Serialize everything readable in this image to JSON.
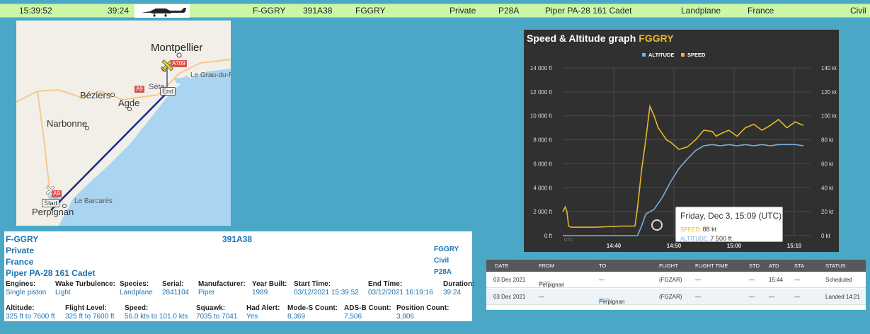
{
  "top_bar": {
    "time": "15:39:52",
    "duration": "39:24",
    "registration": "F-GGRY",
    "mode_s": "391A38",
    "callsign": "FGGRY",
    "owner": "Private",
    "type_code": "P28A",
    "model": "Piper PA-28 161 Cadet",
    "aircraft_class": "Landplane",
    "country": "France",
    "category": "Civil"
  },
  "map": {
    "cities": [
      "Montpellier",
      "Béziers",
      "Agde",
      "Narbonne",
      "Perpignan",
      "Sète"
    ],
    "towns": [
      "Le Grau-du-Roi",
      "Le Barcarès"
    ],
    "roads": [
      "A709",
      "A9",
      "A9"
    ],
    "markers": {
      "start": "Start",
      "end": "End"
    },
    "colors": {
      "sea": "#a9d4f2",
      "land": "#f2efe9",
      "track": "#1a2a8a"
    }
  },
  "info": {
    "registration": "F-GGRY",
    "mode_s": "391A38",
    "owner": "Private",
    "country": "France",
    "model": "Piper PA-28 161 Cadet",
    "callsign": "FGGRY",
    "category": "Civil",
    "type_code": "P28A",
    "row1": [
      {
        "label": "Engines:",
        "value": "Single piston"
      },
      {
        "label": "Wake Turbulence:",
        "value": "Light"
      },
      {
        "label": "Species:",
        "value": "Landplane"
      },
      {
        "label": "Serial:",
        "value": "2841104"
      },
      {
        "label": "Manufacturer:",
        "value": "Piper"
      },
      {
        "label": "Year Built:",
        "value": "1989"
      },
      {
        "label": "Start Time:",
        "value": "03/12/2021 15:39:52"
      },
      {
        "label": "End Time:",
        "value": "03/12/2021 16:19:16"
      },
      {
        "label": "Duration:",
        "value": "39:24"
      }
    ],
    "row2": [
      {
        "label": "Altitude:",
        "value": "325 ft to 7600 ft"
      },
      {
        "label": "Flight Level:",
        "value": "325 ft to 7600 ft"
      },
      {
        "label": "Speed:",
        "value": "56.0 kts to 101.0 kts"
      },
      {
        "label": "Squawk:",
        "value": "7035 to 7041"
      },
      {
        "label": "Had Alert:",
        "value": "Yes"
      },
      {
        "label": "Mode-S Count:",
        "value": "8,369"
      },
      {
        "label": "ADS-B Count:",
        "value": "7,506"
      },
      {
        "label": "Position Count:",
        "value": "3,806"
      }
    ]
  },
  "chart_data": {
    "type": "line",
    "title": "Speed & Altitude graph",
    "title_highlight": "FGGRY",
    "legend": [
      "ALTITUDE",
      "SPEED"
    ],
    "legend_position": "top-center",
    "grid": true,
    "x_tick_labels": [
      "UTC",
      "14:40",
      "14:50",
      "15:00",
      "15:10"
    ],
    "y_left_ticks": [
      "0 ft",
      "2 000 ft",
      "4 000 ft",
      "6 000 ft",
      "8 000 ft",
      "10 000 ft",
      "12 000 ft",
      "14 000 ft"
    ],
    "y_right_ticks": [
      "0 kt",
      "20 kt",
      "40 kt",
      "60 kt",
      "80 kt",
      "100 kt",
      "120 kt",
      "140 kt"
    ],
    "y_left_range": [
      0,
      14000
    ],
    "y_right_range": [
      0,
      140
    ],
    "x_range_minutes": [
      -9,
      20
    ],
    "series": [
      {
        "name": "ALTITUDE",
        "color": "#7aaede",
        "axis": "left",
        "x": [
          -9,
          0,
          0.5,
          1,
          2,
          3,
          4,
          5,
          6,
          7,
          8,
          9,
          10,
          11,
          12,
          13,
          14,
          15,
          16,
          17,
          18,
          19,
          20
        ],
        "y": [
          0,
          0,
          800,
          1800,
          2200,
          3200,
          4500,
          5600,
          6400,
          7100,
          7500,
          7600,
          7500,
          7600,
          7500,
          7600,
          7500,
          7600,
          7500,
          7600,
          7600,
          7600,
          7500
        ]
      },
      {
        "name": "SPEED",
        "color": "#e8b829",
        "axis": "right",
        "x": [
          -9,
          -8.7,
          -8.5,
          -8.3,
          -8,
          -5,
          -2,
          -0.3,
          0,
          0.5,
          1,
          1.5,
          2,
          2.5,
          3,
          3.5,
          4,
          5,
          6,
          7,
          8,
          9,
          9.5,
          10,
          11,
          12,
          13,
          14,
          15,
          16,
          17,
          18,
          19,
          20
        ],
        "y": [
          20,
          24,
          20,
          8,
          7,
          7,
          8,
          8,
          23,
          55,
          80,
          108,
          100,
          90,
          85,
          80,
          78,
          72,
          74,
          80,
          88,
          87,
          83,
          85,
          88,
          83,
          90,
          93,
          88,
          92,
          97,
          90,
          95,
          92
        ]
      }
    ],
    "tooltip": {
      "title": "Friday, Dec 3, 15:09 (UTC)",
      "speed_label": "SPEED:",
      "speed_value": "88 kt",
      "altitude_label": "ALTITUDE:",
      "altitude_value": "7 500 ft"
    }
  },
  "flights": {
    "headers": [
      "DATE",
      "FROM",
      "TO",
      "FLIGHT",
      "FLIGHT TIME",
      "STD",
      "ATD",
      "STA",
      "STATUS"
    ],
    "rows": [
      {
        "date": "03 Dec 2021",
        "from": "Perpignan",
        "from_code": "(PGF)",
        "to": "—",
        "to_code": "",
        "flight": "(FGZAR)",
        "flight_time": "—",
        "std": "—",
        "atd": "15:44",
        "sta": "—",
        "status": "Scheduled"
      },
      {
        "date": "03 Dec 2021",
        "from": "—",
        "from_code": "",
        "to": "Perpignan",
        "to_code": "(PGF)",
        "flight": "(FGZAR)",
        "flight_time": "—",
        "std": "—",
        "atd": "—",
        "sta": "—",
        "status": "Landed 14:21"
      }
    ]
  }
}
